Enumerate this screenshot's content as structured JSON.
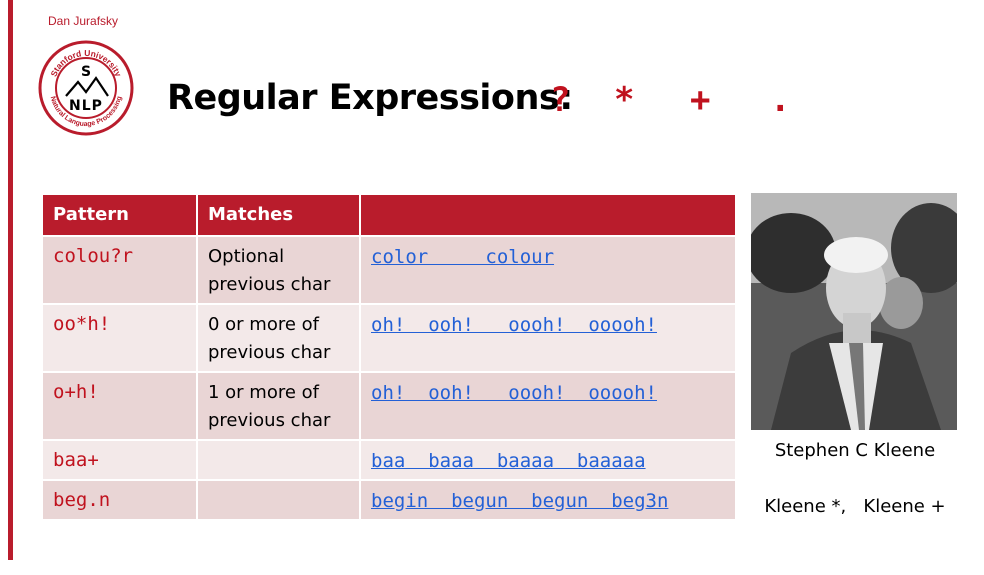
{
  "header": {
    "author": "Dan Jurafsky",
    "title": "Regular Expressions:",
    "ops": [
      "?",
      "*",
      "+",
      "."
    ],
    "logo": {
      "ring_text_top": "Stanford University",
      "ring_text_bottom": "Natural Language Processing",
      "letters": [
        "S",
        "NLP"
      ]
    }
  },
  "table": {
    "headers": [
      "Pattern",
      "Matches",
      ""
    ],
    "rows": [
      {
        "pattern": "colou?r",
        "desc": [
          "Optional",
          "previous char"
        ],
        "examples": "color     colour"
      },
      {
        "pattern": "oo*h!",
        "desc": [
          "0 or more of",
          "previous char"
        ],
        "examples": "oh!  ooh!   oooh!  ooooh!"
      },
      {
        "pattern": "o+h!",
        "desc": [
          "1 or more of",
          "previous char"
        ],
        "examples": "oh!  ooh!   oooh!  ooooh!"
      },
      {
        "pattern": "baa+",
        "desc": [
          "",
          ""
        ],
        "examples": "baa  baaa  baaaa  baaaaa"
      },
      {
        "pattern": "beg.n",
        "desc": [
          "",
          ""
        ],
        "examples": "begin  begun  begun  beg3n"
      }
    ]
  },
  "photo": {
    "caption": "Stephen C Kleene",
    "subcaption": "Kleene *,   Kleene +"
  },
  "colors": {
    "accent": "#b91c2c",
    "row_dark": "#e9d5d5",
    "row_light": "#f3e9e9",
    "link": "#2360d6"
  }
}
